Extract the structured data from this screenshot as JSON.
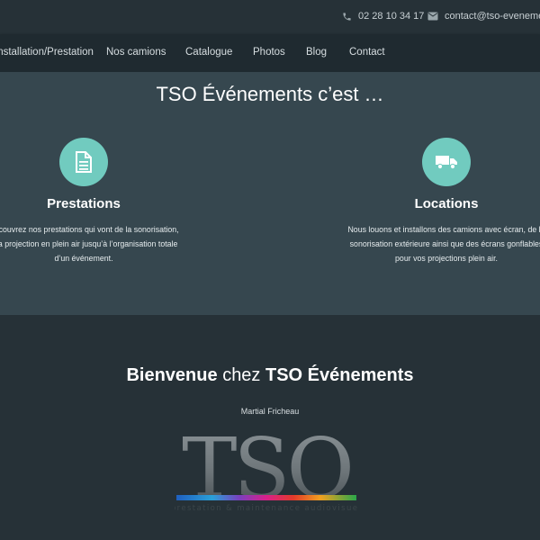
{
  "topbar": {
    "phone": "02 28 10 34 17",
    "email": "contact@tso-evenements",
    "phone_icon": "phone-icon",
    "email_icon": "envelope-icon"
  },
  "nav": {
    "items": [
      {
        "label": "Installation/Prestation"
      },
      {
        "label": "Nos camions"
      },
      {
        "label": "Catalogue"
      },
      {
        "label": "Photos"
      },
      {
        "label": "Blog"
      },
      {
        "label": "Contact"
      }
    ]
  },
  "intro": {
    "title": "TSO Événements c’est …",
    "features": [
      {
        "icon": "document-icon",
        "title": "Prestations",
        "lines": [
          "Découvrez nos prestations qui vont de la sonorisation,",
          "à la projection en plein air jusqu’à l’organisation totale",
          "d’un événement."
        ]
      },
      {
        "icon": "truck-icon",
        "title": "Locations",
        "lines": [
          "Nous louons et installons des camions avec écran, de la",
          "sonorisation extérieure ainsi que des écrans gonflables",
          "pour vos projections plein air."
        ]
      }
    ]
  },
  "welcome": {
    "title_bold_1": "Bienvenue",
    "title_light": "chez",
    "title_bold_2": "TSO Événements",
    "author": "Martial Fricheau"
  },
  "logo": {
    "text": "TSO",
    "tagline": "prestation & maintenance audiovisuel"
  },
  "colors": {
    "accent": "#71cbbf",
    "intro_bg": "#36474f",
    "page_bg": "#263137",
    "nav_bg": "#1f2a30"
  }
}
